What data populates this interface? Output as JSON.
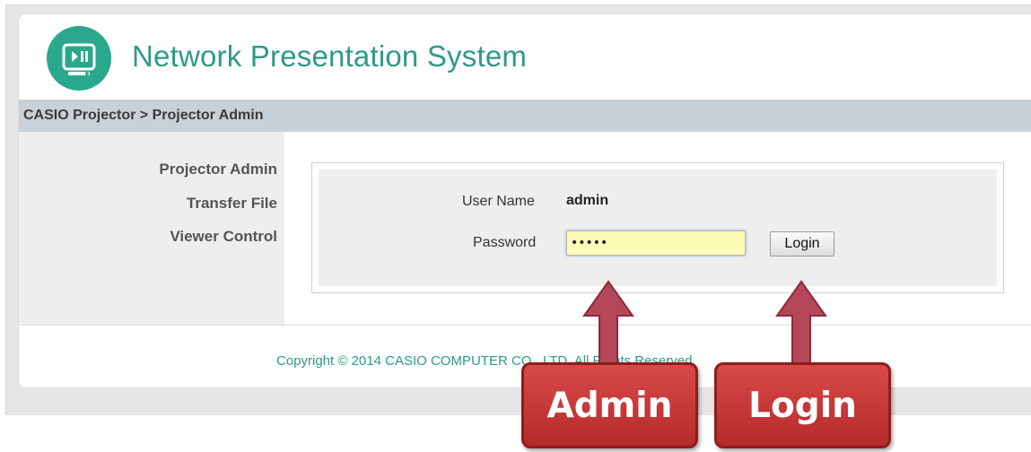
{
  "header": {
    "title": "Network Presentation System",
    "logo_icon": "presentation-play-pause-icon"
  },
  "breadcrumb": "CASIO Projector > Projector Admin",
  "sidebar": {
    "items": [
      {
        "label": "Projector Admin"
      },
      {
        "label": "Transfer File"
      },
      {
        "label": "Viewer Control"
      }
    ]
  },
  "login_form": {
    "username_label": "User Name",
    "username_value": "admin",
    "password_label": "Password",
    "password_value": "•••••",
    "login_label": "Login"
  },
  "footer": {
    "copyright": "Copyright © 2014 CASIO COMPUTER CO., LTD. All Rights Reserved."
  },
  "callouts": {
    "admin": "Admin",
    "login": "Login"
  },
  "colors": {
    "brand": "#2aa88c",
    "callout": "#c0392b",
    "password_field_bg": "#fbfbb6"
  }
}
